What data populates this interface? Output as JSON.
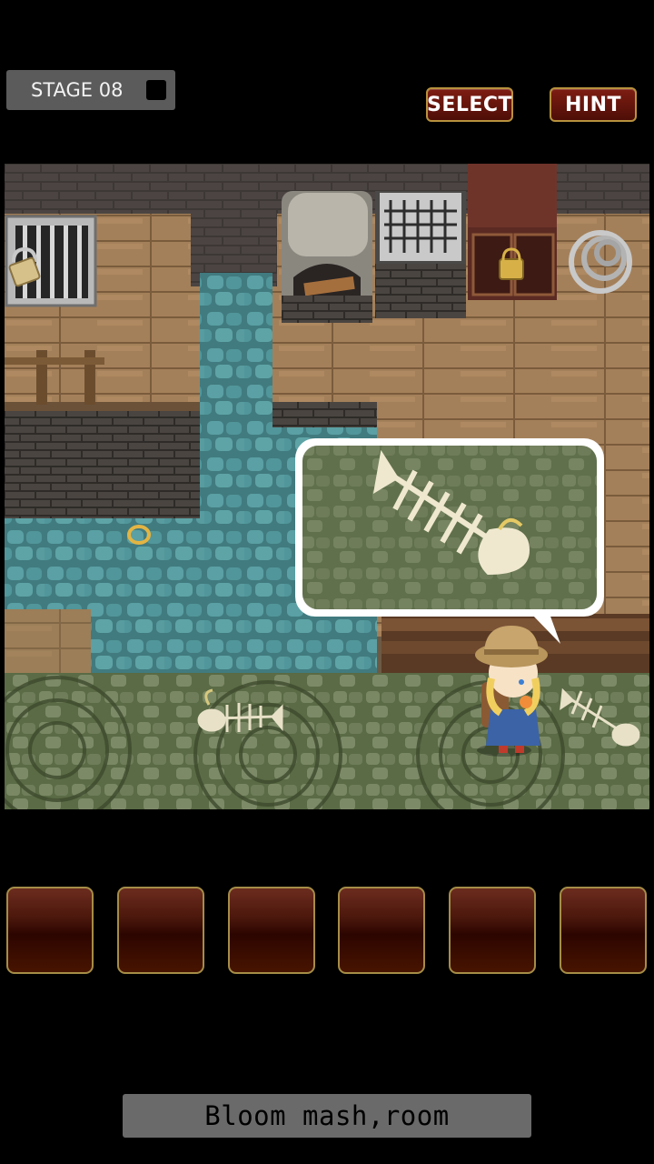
{
  "header": {
    "stage_label": "STAGE 08",
    "select_label": "SELECT",
    "hint_label": "HINT"
  },
  "scene": {
    "name": "sewer-room",
    "objects": [
      "barred-window",
      "padlock",
      "stone-oven",
      "iron-grate",
      "locked-cabinet",
      "rope-coil",
      "water-channel",
      "gold-ring",
      "fish-skeleton",
      "fish-skeleton",
      "girl-explorer"
    ],
    "speech_bubble": {
      "item": "fish-skeleton"
    }
  },
  "inventory": {
    "slots": 6,
    "items": [
      "",
      "",
      "",
      "",
      "",
      ""
    ]
  },
  "message": "Bloom mash,room",
  "colors": {
    "button_red": "#6e1a10",
    "button_border": "#b8923e",
    "slot_border": "#a58d47",
    "water": "#4f8d92"
  }
}
